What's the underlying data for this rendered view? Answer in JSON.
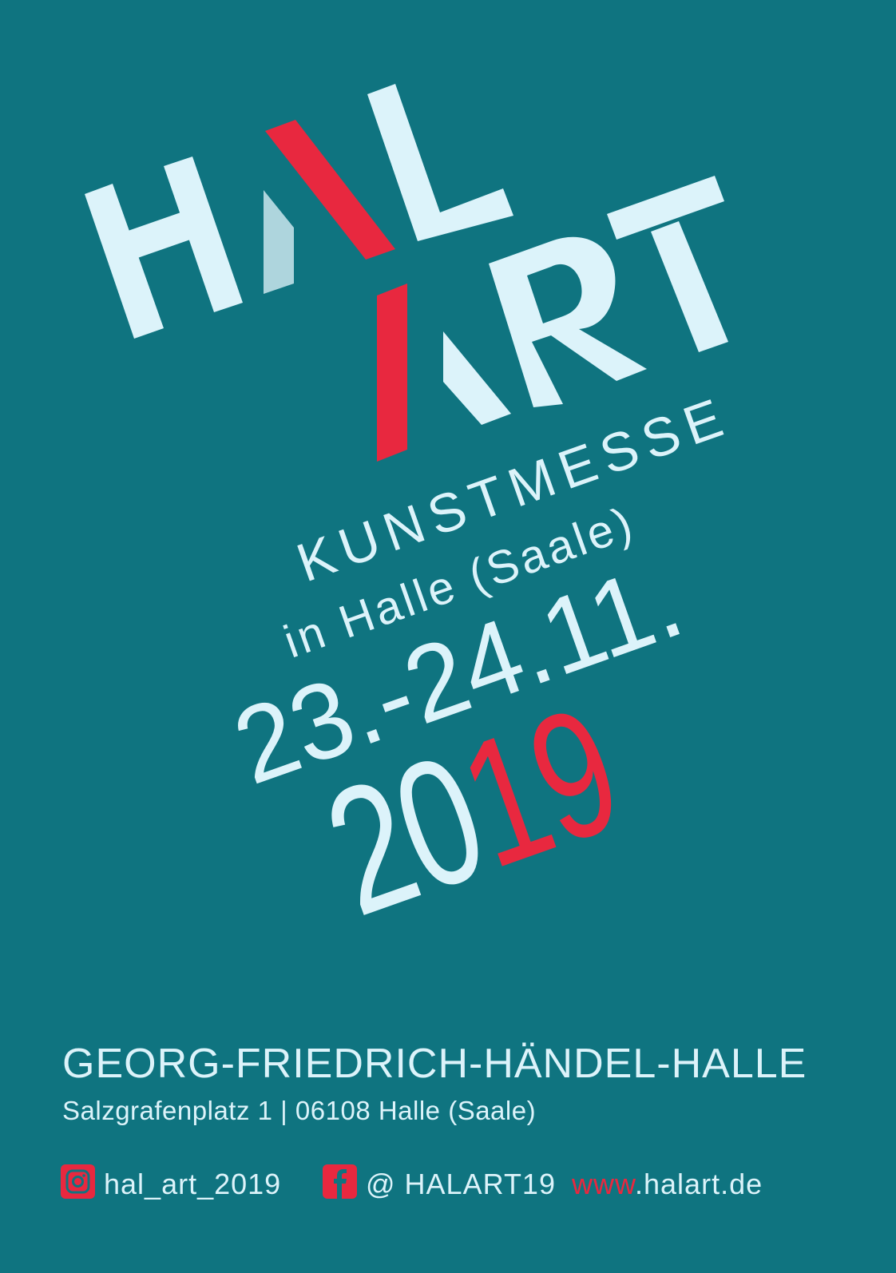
{
  "colors": {
    "background": "#0f7480",
    "light": "#dcf3fa",
    "accent": "#e8283f",
    "muted": "#aed5dd"
  },
  "logo": {
    "text": "HAL ART"
  },
  "event": {
    "title": "KUNSTMESSE",
    "location_line": "in Halle (Saale)",
    "dates": "23.-24.11.",
    "year_prefix": "20",
    "year_suffix": "19"
  },
  "venue": {
    "name": "GEORG-FRIEDRICH-HÄNDEL-HALLE",
    "address": "Salzgrafenplatz 1 | 06108 Halle (Saale)"
  },
  "social": {
    "instagram": {
      "icon": "instagram-icon",
      "handle": "hal_art_2019"
    },
    "facebook": {
      "icon": "facebook-icon",
      "handle": "@ HALART19"
    },
    "website": {
      "prefix": "www",
      "domain": ".halart.de"
    }
  }
}
